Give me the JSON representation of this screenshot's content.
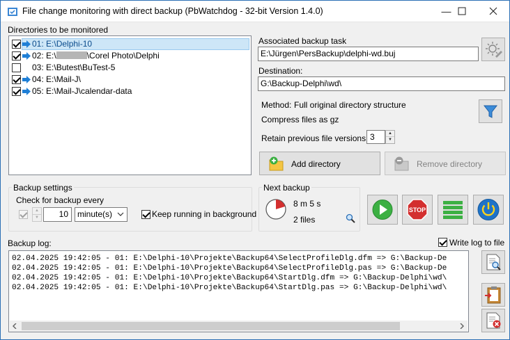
{
  "window": {
    "title": "File change monitoring with direct backup (PbWatchdog - 32-bit Version 1.4.0)"
  },
  "dirs": {
    "heading": "Directories to be monitored",
    "items": [
      {
        "label": "01: E:\\Delphi-10",
        "checked": true,
        "arrow": true
      },
      {
        "label_a": "02: E:\\",
        "label_b": "\\Corel Photo\\Delphi",
        "checked": true,
        "arrow": true
      },
      {
        "label": "03: E:\\Butest\\BuTest-5",
        "checked": false,
        "arrow": false
      },
      {
        "label": "04: E:\\Mail-J\\",
        "checked": true,
        "arrow": true
      },
      {
        "label": "05: E:\\Mail-J\\calendar-data",
        "checked": true,
        "arrow": true
      }
    ]
  },
  "task": {
    "heading": "Associated backup task",
    "value": "E:\\Jürgen\\PersBackup\\delphi-wd.buj"
  },
  "destination": {
    "heading": "Destination:",
    "value": "G:\\Backup-Delphi\\wd\\"
  },
  "method": {
    "label": "Method:",
    "value": "Full original directory structure",
    "compress": "Compress files as gz"
  },
  "retain": {
    "label": "Retain previous file versions:",
    "value": "3"
  },
  "buttons": {
    "add": "Add directory",
    "remove": "Remove directory"
  },
  "settings": {
    "heading": "Backup settings",
    "check_label": "Check for backup every",
    "interval": "10",
    "unit": "minute(s)",
    "keep_running": "Keep running in background"
  },
  "next": {
    "heading": "Next backup",
    "time": "8 m 5 s",
    "files": "2 files"
  },
  "log": {
    "heading": "Backup log:",
    "write_label": "Write log to file",
    "lines": [
      "02.04.2025 19:42:05 - 01: E:\\Delphi-10\\Projekte\\Backup64\\SelectProfileDlg.dfm => G:\\Backup-De",
      "02.04.2025 19:42:05 - 01: E:\\Delphi-10\\Projekte\\Backup64\\SelectProfileDlg.pas => G:\\Backup-De",
      "02.04.2025 19:42:05 - 01: E:\\Delphi-10\\Projekte\\Backup64\\StartDlg.dfm => G:\\Backup-Delphi\\wd\\",
      "02.04.2025 19:42:05 - 01: E:\\Delphi-10\\Projekte\\Backup64\\StartDlg.pas => G:\\Backup-Delphi\\wd\\"
    ]
  },
  "colors": {
    "accent": "#2b6fb5",
    "arrow": "#1f7fd6",
    "stop": "#d32f2f",
    "green": "#3cb043",
    "power": "#1e73c9"
  }
}
